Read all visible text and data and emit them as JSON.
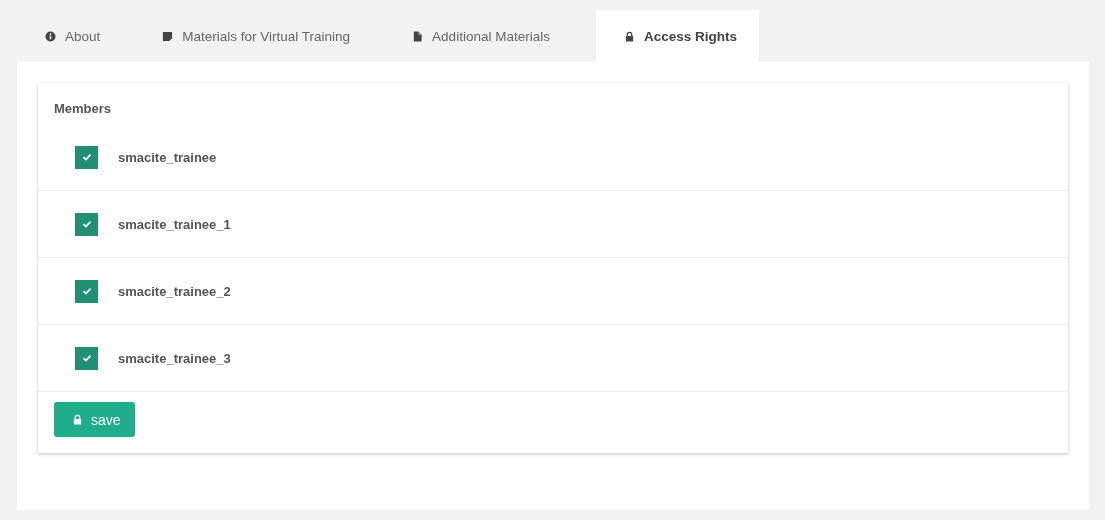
{
  "tabs": [
    {
      "label": "About",
      "selected": false
    },
    {
      "label": "Materials for Virtual Training",
      "selected": false
    },
    {
      "label": "Additional Materials",
      "selected": false
    },
    {
      "label": "Access Rights",
      "selected": true
    }
  ],
  "members": {
    "title": "Members",
    "items": [
      {
        "name": "smacite_trainee",
        "checked": true
      },
      {
        "name": "smacite_trainee_1",
        "checked": true
      },
      {
        "name": "smacite_trainee_2",
        "checked": true
      },
      {
        "name": "smacite_trainee_3",
        "checked": true
      }
    ]
  },
  "save_button": {
    "label": "save"
  }
}
